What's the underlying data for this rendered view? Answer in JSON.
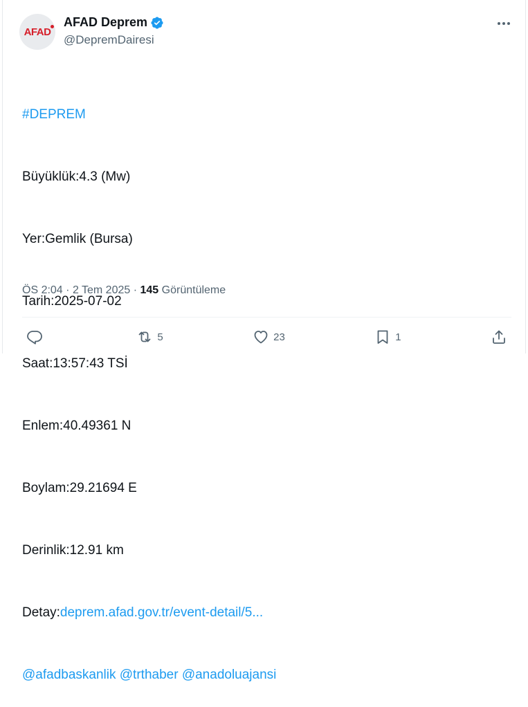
{
  "author": {
    "avatar_text": "AFAD",
    "display_name": "AFAD Deprem",
    "handle": "@DepremDairesi"
  },
  "tweet": {
    "hashtag": "#DEPREM",
    "lines": [
      "Büyüklük:4.3 (Mw)",
      "Yer:Gemlik (Bursa)",
      "Tarih:2025-07-02",
      "Saat:13:57:43 TSİ",
      "Enlem:40.49361 N",
      "Boylam:29.21694 E",
      "Derinlik:12.91 km"
    ],
    "detail_label": "Detay:",
    "detail_link": "deprem.afad.gov.tr/event-detail/5...",
    "mentions": [
      "@afadbaskanlik",
      "@trthaber",
      "@anadoluajansi"
    ]
  },
  "meta": {
    "time": "ÖS 2:04",
    "separator": "·",
    "date": "2 Tem 2025",
    "views_count": "145",
    "views_label": "Görüntüleme"
  },
  "actions": {
    "reply_count": "",
    "retweet_count": "5",
    "like_count": "23",
    "bookmark_count": "1"
  },
  "colors": {
    "link": "#1d9bf0",
    "text": "#0f1419",
    "secondary": "#536471",
    "verified": "#1d9bf0",
    "brand_red": "#d61f2a"
  }
}
